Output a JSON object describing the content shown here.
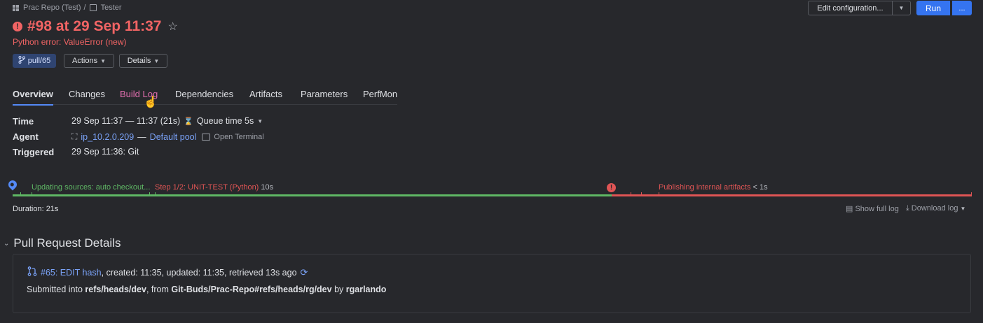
{
  "breadcrumb": {
    "project": "Prac Repo (Test)",
    "separator": "/",
    "config": "Tester"
  },
  "build": {
    "title": "#98 at 29 Sep 11:37",
    "star": "☆",
    "error_summary": "Python error: ValueError (new)",
    "branch_label": "pull/65",
    "actions_label": "Actions",
    "details_label": "Details"
  },
  "top_actions": {
    "edit_configuration": "Edit configuration...",
    "run": "Run",
    "more": "..."
  },
  "tabs": [
    "Overview",
    "Changes",
    "Build Log",
    "Dependencies",
    "Artifacts",
    "Parameters",
    "PerfMon"
  ],
  "info": {
    "time_label": "Time",
    "time_value": "29 Sep 11:37 — 11:37 (21s)",
    "queue_time": "Queue time 5s",
    "agent_label": "Agent",
    "agent_name": "ip_10.2.0.209",
    "agent_sep": "—",
    "agent_pool": "Default pool",
    "open_terminal": "Open Terminal",
    "triggered_label": "Triggered",
    "triggered_value": "29 Sep 11:36: Git"
  },
  "timeline": {
    "stage1": "Updating sources: auto checkout...",
    "stage2_name": "Step 1/2: UNIT-TEST (Python)",
    "stage2_time": "10s",
    "stage3_name": "Publishing internal artifacts",
    "stage3_time": "< 1s",
    "duration": "Duration: 21s",
    "show_full_log": "Show full log",
    "download_log": "Download log",
    "colors": {
      "success": "#5fb865",
      "failure": "#e05555"
    }
  },
  "pull_request": {
    "section_title": "Pull Request Details",
    "pr_link": "#65: EDIT hash",
    "pr_meta": ", created: 11:35, updated: 11:35, retrieved 13s ago",
    "submitted_prefix": "Submitted into ",
    "target_branch": "refs/heads/dev",
    "from_text": ", from ",
    "source_branch": "Git-Buds/Prac-Repo#refs/heads/rg/dev",
    "by_text": " by ",
    "author": "rgarlando"
  }
}
